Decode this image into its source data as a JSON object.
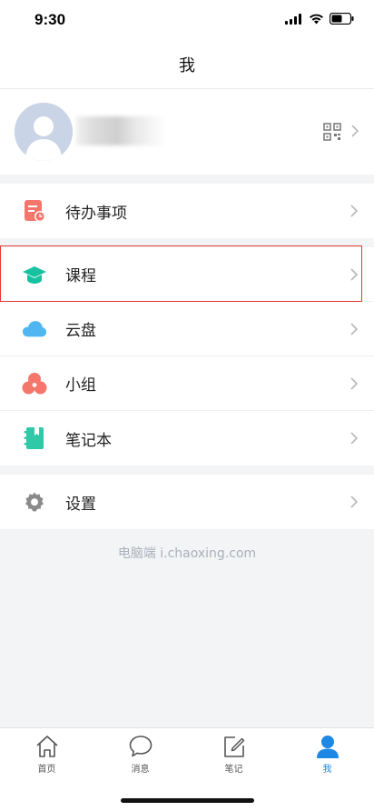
{
  "status_bar": {
    "time": "9:30"
  },
  "header": {
    "title": "我"
  },
  "profile": {
    "avatar": "default-avatar",
    "qr_icon": "qr-code-icon"
  },
  "menu_group_1": [
    {
      "label": "待办事项",
      "icon": "todo-list-icon",
      "color": "#f5766b"
    }
  ],
  "menu_group_2": [
    {
      "label": "课程",
      "icon": "graduation-cap-icon",
      "color": "#18c2a0"
    },
    {
      "label": "云盘",
      "icon": "cloud-icon",
      "color": "#4fb6f2"
    },
    {
      "label": "小组",
      "icon": "group-icon",
      "color": "#f5766b"
    },
    {
      "label": "笔记本",
      "icon": "notebook-icon",
      "color": "#2fc9a8"
    }
  ],
  "menu_group_3": [
    {
      "label": "设置",
      "icon": "gear-icon",
      "color": "#8a8a8a"
    }
  ],
  "footer": {
    "link_text": "电脑端 i.chaoxing.com"
  },
  "tabs": [
    {
      "label": "首页",
      "icon": "home-icon"
    },
    {
      "label": "消息",
      "icon": "message-bubble-icon"
    },
    {
      "label": "笔记",
      "icon": "note-edit-icon"
    },
    {
      "label": "我",
      "icon": "person-icon",
      "active": true
    }
  ],
  "accent_color": "#1e88e5"
}
